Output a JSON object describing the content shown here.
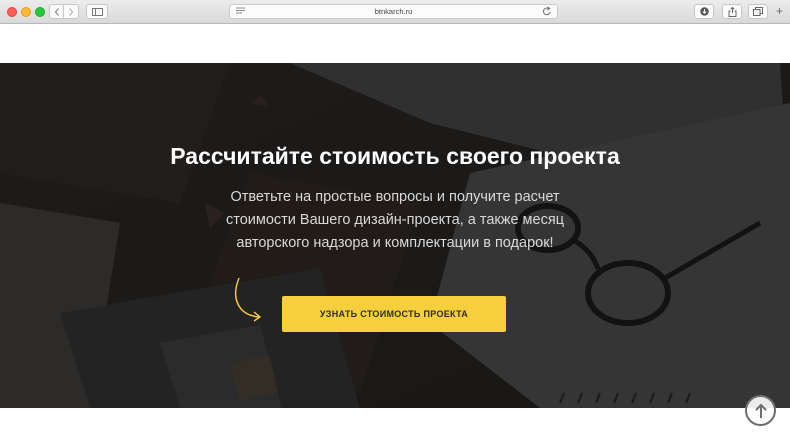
{
  "browser": {
    "url": "btnkarch.ru"
  },
  "hero": {
    "title": "Рассчитайте стоимость своего проекта",
    "line1": "Ответьте на простые вопросы и получите расчет",
    "line2": "стоимости Вашего дизайн-проекта, а также месяц",
    "line3": "авторского надзора и комплектации в подарок!",
    "cta_label": "УЗНАТЬ СТОИМОСТЬ ПРОЕКТА"
  },
  "colors": {
    "accent": "#f7cf3c",
    "hero_overlay": "#1a1a1a",
    "title": "#ffffff"
  },
  "icons": {
    "back": "chevron-left-icon",
    "forward": "chevron-right-icon",
    "sidebar": "sidebar-icon",
    "reader": "reader-icon",
    "reload": "reload-icon",
    "download": "download-icon",
    "share": "share-icon",
    "tabs": "tabs-icon",
    "new_tab": "plus-icon",
    "cta_arrow": "curved-arrow-icon",
    "scroll_top": "arrow-up-icon"
  }
}
